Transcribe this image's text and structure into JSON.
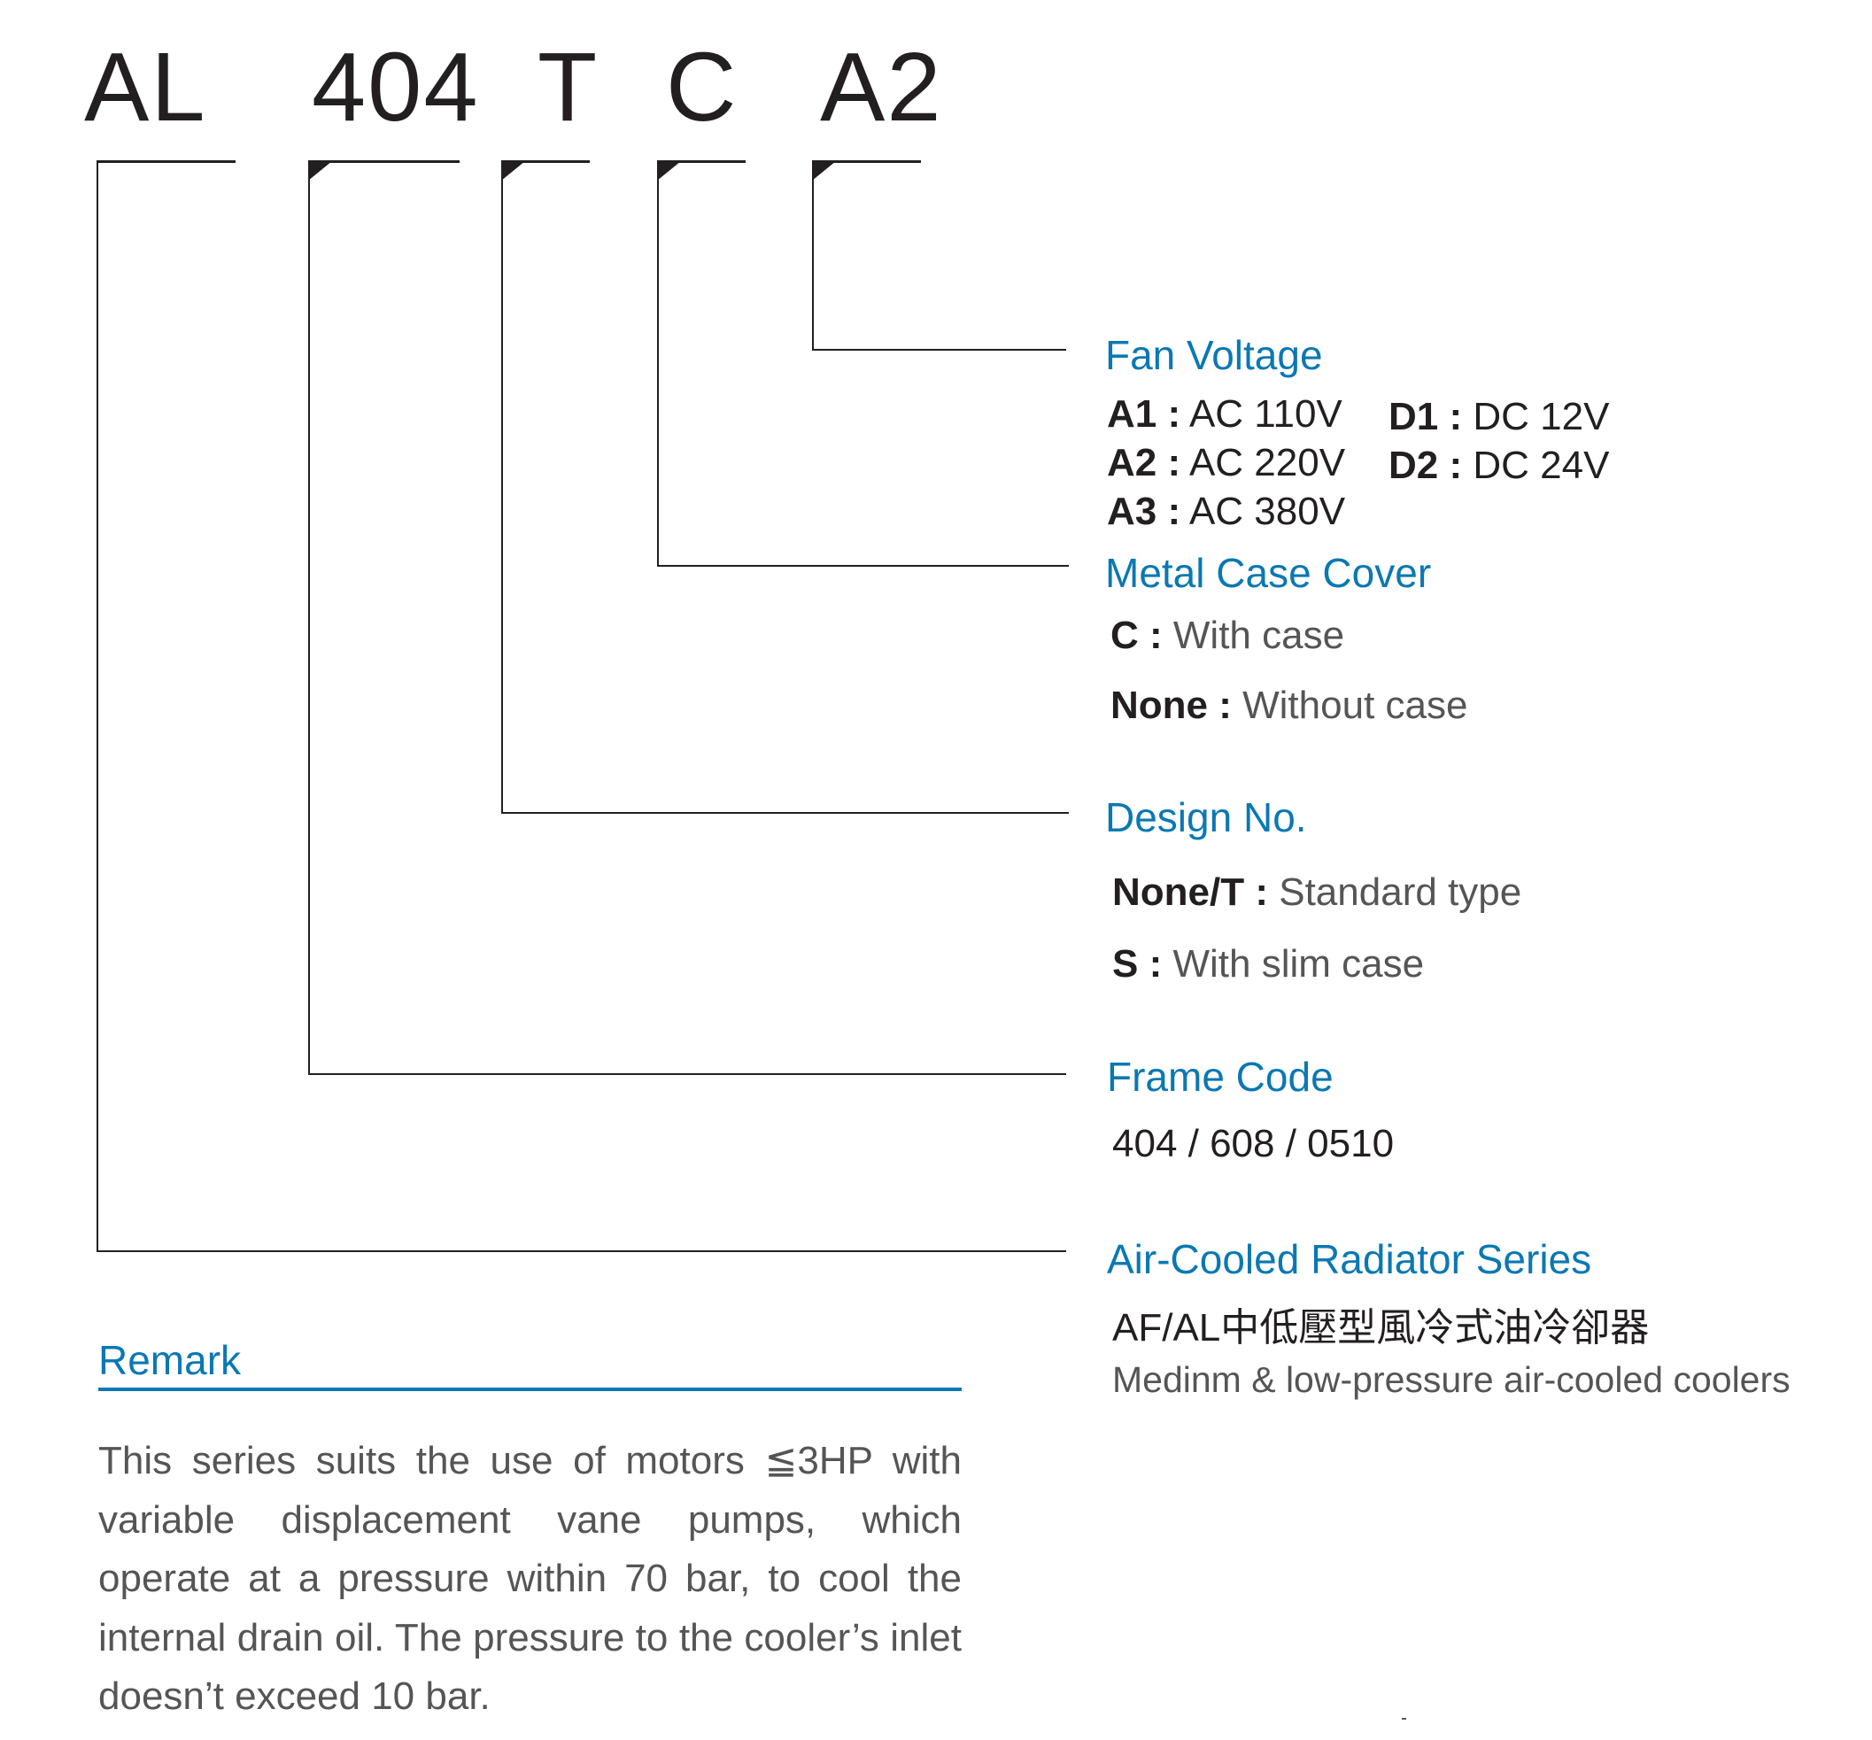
{
  "model_code": {
    "segments": [
      "AL",
      "404",
      "T",
      "C",
      "A2"
    ]
  },
  "fan_voltage": {
    "heading": "Fan Voltage",
    "options_ac": [
      {
        "code": "A1",
        "sep": ":",
        "value": "AC 110V"
      },
      {
        "code": "A2",
        "sep": ":",
        "value": "AC 220V"
      },
      {
        "code": "A3",
        "sep": ":",
        "value": "AC 380V"
      }
    ],
    "options_dc": [
      {
        "code": "D1",
        "sep": ":",
        "value": "DC 12V"
      },
      {
        "code": "D2",
        "sep": ":",
        "value": "DC 24V"
      }
    ]
  },
  "metal_case_cover": {
    "heading": "Metal Case Cover",
    "options": [
      {
        "code": "C",
        "sep": ":",
        "value": "With case"
      },
      {
        "code": "None",
        "sep": ":",
        "value": "Without case"
      }
    ]
  },
  "design_no": {
    "heading": "Design No.",
    "options": [
      {
        "code": "None/T",
        "sep": ":",
        "value": "Standard type"
      },
      {
        "code": "S",
        "sep": ":",
        "value": "With slim case"
      }
    ]
  },
  "frame_code": {
    "heading": "Frame Code",
    "values": "404 / 608 / 0510"
  },
  "series": {
    "heading": "Air-Cooled Radiator Series",
    "chinese_name": "AF/AL中低壓型風冷式油冷卻器",
    "english_name": "Medinm & low-pressure air-cooled coolers"
  },
  "remark": {
    "heading": "Remark",
    "body": "This series suits the use of motors ≦3HP with variable displacement vane pumps, which operate at a pressure within 70 bar, to cool the internal drain oil. The pressure to the cooler’s inlet doesn’t exceed 10 bar."
  },
  "colors": {
    "accent_blue": "#0b78b3",
    "text_dark": "#231f20",
    "text_gray": "#555555"
  }
}
